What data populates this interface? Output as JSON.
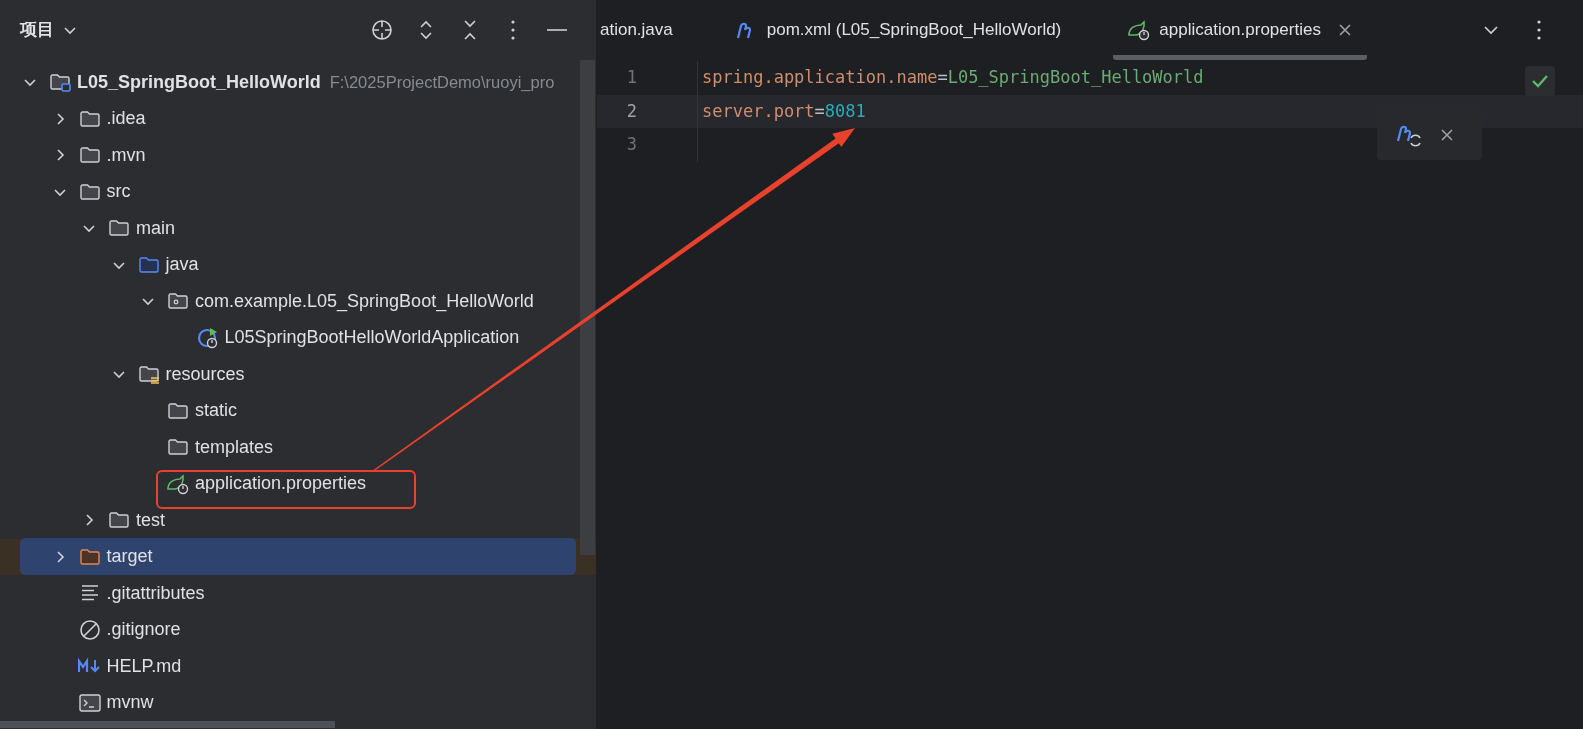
{
  "project_panel": {
    "title": "项目",
    "tree": [
      {
        "label": "L05_SpringBoot_HelloWorld",
        "path": "F:\\2025ProjectDemo\\ruoyi_pro",
        "kind": "module",
        "expanded": true,
        "selected": false,
        "children": [
          {
            "label": ".idea",
            "kind": "folder",
            "expanded": false,
            "selected": false
          },
          {
            "label": ".mvn",
            "kind": "folder",
            "expanded": false,
            "selected": false
          },
          {
            "label": "src",
            "kind": "folder",
            "expanded": true,
            "selected": false,
            "children": [
              {
                "label": "main",
                "kind": "folder",
                "expanded": true,
                "selected": false,
                "children": [
                  {
                    "label": "java",
                    "kind": "source",
                    "expanded": true,
                    "selected": false,
                    "children": [
                      {
                        "label": "com.example.L05_SpringBoot_HelloWorld",
                        "kind": "package",
                        "expanded": true,
                        "selected": false,
                        "children": [
                          {
                            "label": "L05SpringBootHelloWorldApplication",
                            "kind": "application",
                            "selected": false
                          }
                        ]
                      }
                    ]
                  },
                  {
                    "label": "resources",
                    "kind": "resources",
                    "expanded": true,
                    "selected": false,
                    "children": [
                      {
                        "label": "static",
                        "kind": "folder",
                        "selected": false
                      },
                      {
                        "label": "templates",
                        "kind": "folder",
                        "selected": false
                      },
                      {
                        "label": "application.properties",
                        "kind": "properties",
                        "selected": false
                      }
                    ]
                  }
                ]
              },
              {
                "label": "test",
                "kind": "folder",
                "expanded": false,
                "selected": false
              }
            ]
          },
          {
            "label": "target",
            "kind": "excluded",
            "expanded": false,
            "selected": true
          },
          {
            "label": ".gitattributes",
            "kind": "text",
            "selected": false
          },
          {
            "label": ".gitignore",
            "kind": "ignore",
            "selected": false
          },
          {
            "label": "HELP.md",
            "kind": "markdown",
            "selected": false
          },
          {
            "label": "mvnw",
            "kind": "shell",
            "selected": false
          }
        ]
      }
    ]
  },
  "editor": {
    "tabs": [
      {
        "label": "ation.java",
        "kind": "plain",
        "selected": false
      },
      {
        "label": "pom.xml (L05_SpringBoot_HelloWorld)",
        "kind": "maven",
        "selected": false
      },
      {
        "label": "application.properties",
        "kind": "properties",
        "selected": true
      }
    ],
    "lines": [
      {
        "number": "1",
        "key": "spring.application.name",
        "sep": "=",
        "value": "L05_SpringBoot_HelloWorld",
        "kind": "string",
        "current": false
      },
      {
        "number": "2",
        "key": "server.port",
        "sep": "=",
        "value": "8081",
        "kind": "number",
        "current": true
      },
      {
        "number": "3",
        "kind": "empty",
        "current": false
      }
    ]
  }
}
